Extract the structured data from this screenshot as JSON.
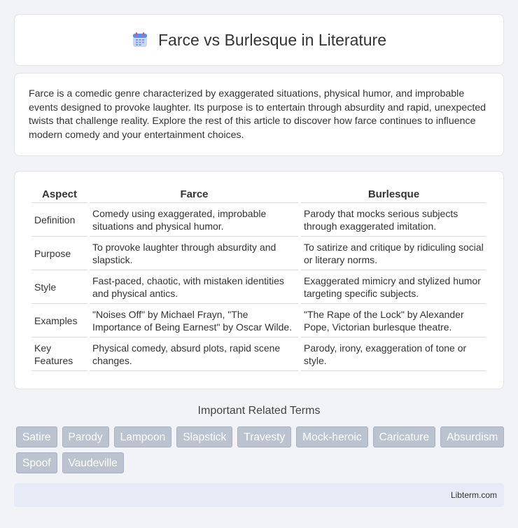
{
  "header": {
    "title": "Farce vs Burlesque in Literature",
    "icon": "calendar-icon"
  },
  "intro": {
    "text": "Farce is a comedic genre characterized by exaggerated situations, physical humor, and improbable events designed to provoke laughter. Its purpose is to entertain through absurdity and rapid, unexpected twists that challenge reality. Explore the rest of this article to discover how farce continues to influence modern comedy and your entertainment choices."
  },
  "table": {
    "headers": [
      "Aspect",
      "Farce",
      "Burlesque"
    ],
    "rows": [
      [
        "Definition",
        "Comedy using exaggerated, improbable situations and physical humor.",
        "Parody that mocks serious subjects through exaggerated imitation."
      ],
      [
        "Purpose",
        "To provoke laughter through absurdity and slapstick.",
        "To satirize and critique by ridiculing social or literary norms."
      ],
      [
        "Style",
        "Fast-paced, chaotic, with mistaken identities and physical antics.",
        "Exaggerated mimicry and stylized humor targeting specific subjects."
      ],
      [
        "Examples",
        "\"Noises Off\" by Michael Frayn, \"The Importance of Being Earnest\" by Oscar Wilde.",
        "\"The Rape of the Lock\" by Alexander Pope, Victorian burlesque theatre."
      ],
      [
        "Key Features",
        "Physical comedy, absurd plots, rapid scene changes.",
        "Parody, irony, exaggeration of tone or style."
      ]
    ]
  },
  "related": {
    "title": "Important Related Terms",
    "tags": [
      "Satire",
      "Parody",
      "Lampoon",
      "Slapstick",
      "Travesty",
      "Mock-heroic",
      "Caricature",
      "Absurdism",
      "Spoof",
      "Vaudeville"
    ]
  },
  "footer": {
    "text": "Libterm.com"
  }
}
